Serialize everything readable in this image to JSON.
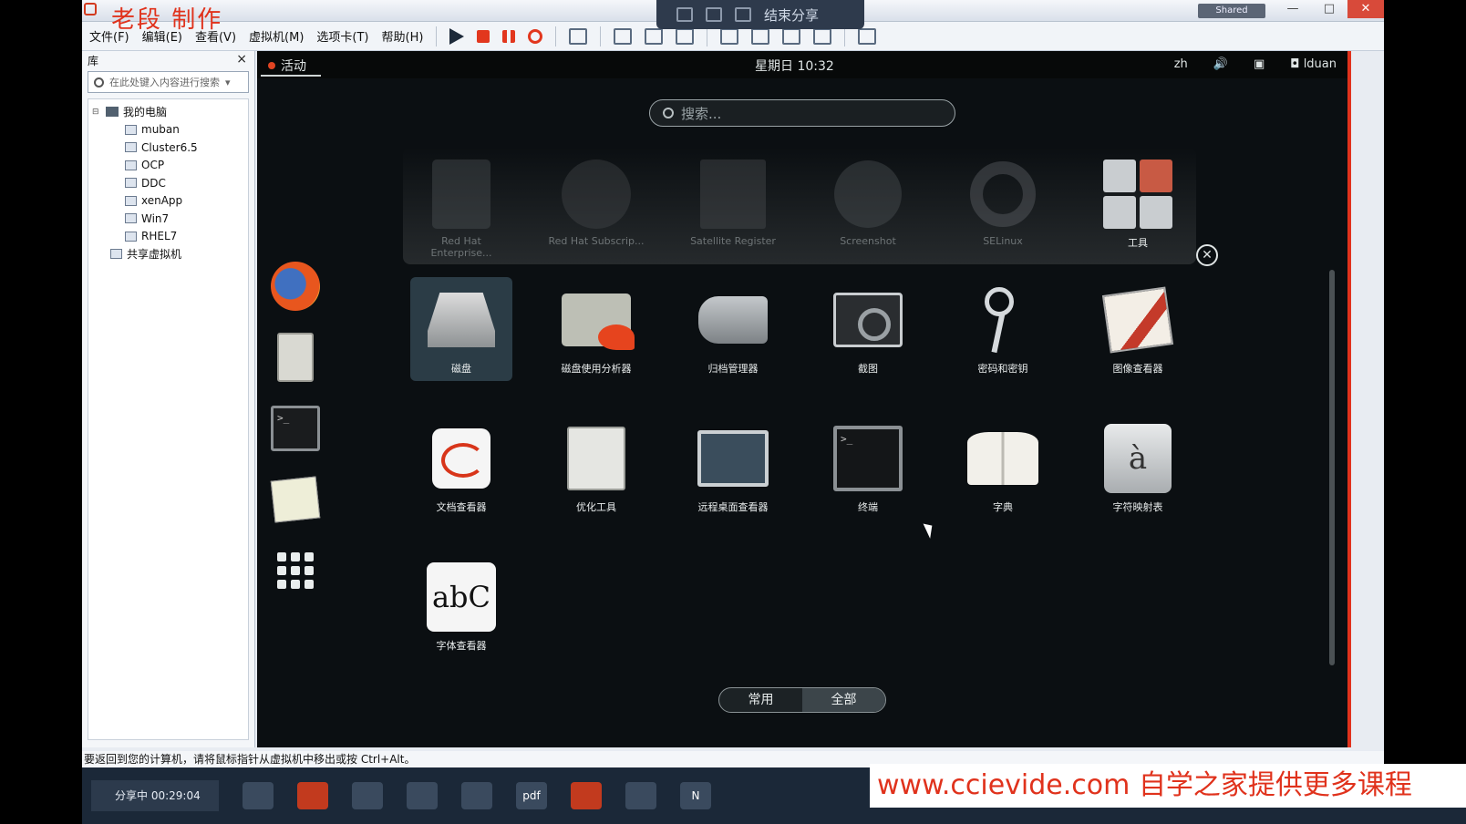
{
  "window": {
    "watermark": "老段 制作",
    "share_bar_label": "结束分享",
    "shared_badge": "Shared",
    "controls": [
      "—",
      "□",
      "✕"
    ]
  },
  "menubar": {
    "items": [
      "文件(F)",
      "编辑(E)",
      "查看(V)",
      "虚拟机(M)",
      "选项卡(T)",
      "帮助(H)"
    ]
  },
  "library": {
    "title": "库",
    "close": "×",
    "search_placeholder": "在此处键入内容进行搜索",
    "root": "我的电脑",
    "vms": [
      "muban",
      "Cluster6.5",
      "OCP",
      "DDC",
      "xenApp",
      "Win7",
      "RHEL7"
    ],
    "shared": "共享虚拟机"
  },
  "gnome": {
    "activities": "活动",
    "clock": "星期日 10:32",
    "lang": "zh",
    "user": "lduan",
    "search_placeholder": "搜索...",
    "folder_apps": [
      {
        "label": "Red Hat Enterprise...",
        "icon": "document-icon"
      },
      {
        "label": "Red Hat Subscrip...",
        "icon": "subscription-icon"
      },
      {
        "label": "Satellite Register",
        "icon": "box-icon"
      },
      {
        "label": "Screenshot",
        "icon": "screenshot-icon"
      },
      {
        "label": "SELinux",
        "icon": "gear-icon"
      },
      {
        "label": "工具",
        "icon": "tools-folder-icon"
      }
    ],
    "apps_row1": [
      {
        "label": "磁盘",
        "icon": "disk-icon"
      },
      {
        "label": "磁盘使用分析器",
        "icon": "disk-usage-icon"
      },
      {
        "label": "归档管理器",
        "icon": "archive-icon"
      },
      {
        "label": "截图",
        "icon": "camera-icon"
      },
      {
        "label": "密码和密钥",
        "icon": "keys-icon"
      },
      {
        "label": "图像查看器",
        "icon": "image-viewer-icon"
      }
    ],
    "apps_row2": [
      {
        "label": "文档查看器",
        "icon": "document-viewer-icon"
      },
      {
        "label": "优化工具",
        "icon": "tweak-icon"
      },
      {
        "label": "远程桌面查看器",
        "icon": "remote-desktop-icon"
      },
      {
        "label": "终端",
        "icon": "terminal-icon"
      },
      {
        "label": "字典",
        "icon": "dictionary-icon"
      },
      {
        "label": "字符映射表",
        "icon": "charmap-icon"
      }
    ],
    "apps_row3": [
      {
        "label": "字体查看器",
        "icon": "font-viewer-icon"
      }
    ],
    "charmap_glyph": "à",
    "font_glyph": "abC",
    "terminal_prompt": ">_",
    "modes": [
      "常用",
      "全部"
    ]
  },
  "status_hint": "要返回到您的计算机，请将鼠标指针从虚拟机中移出或按 Ctrl+Alt。",
  "taskbar": {
    "share_label": "分享中 00:29:04",
    "pdf_label": "pdf",
    "n_label": "N"
  },
  "promo": "www.ccievide.com  自学之家提供更多课程"
}
